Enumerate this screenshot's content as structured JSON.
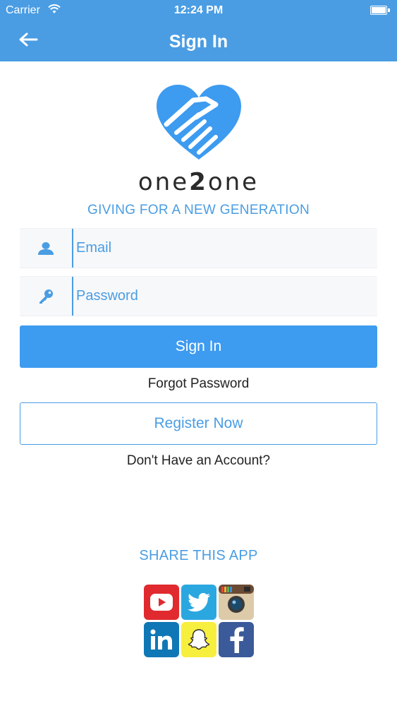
{
  "status_bar": {
    "carrier": "Carrier",
    "time": "12:24 PM"
  },
  "nav": {
    "title": "Sign In",
    "back_icon": "arrow-left-icon"
  },
  "brand": {
    "name_prefix": "one",
    "name_middle": "2",
    "name_suffix": "one",
    "tagline": "GIVING FOR A NEW GENERATION",
    "logo_icon": "heart-handshake-icon"
  },
  "form": {
    "email_placeholder": "Email",
    "password_placeholder": "Password",
    "signin_label": "Sign In",
    "forgot_label": "Forgot Password",
    "register_label": "Register Now",
    "no_account_label": "Don't Have an Account?"
  },
  "share": {
    "title": "SHARE THIS APP",
    "apps": [
      "youtube",
      "twitter",
      "instagram",
      "linkedin",
      "snapchat",
      "facebook"
    ]
  },
  "colors": {
    "accent": "#4a9de3",
    "button": "#3d9bf0"
  }
}
